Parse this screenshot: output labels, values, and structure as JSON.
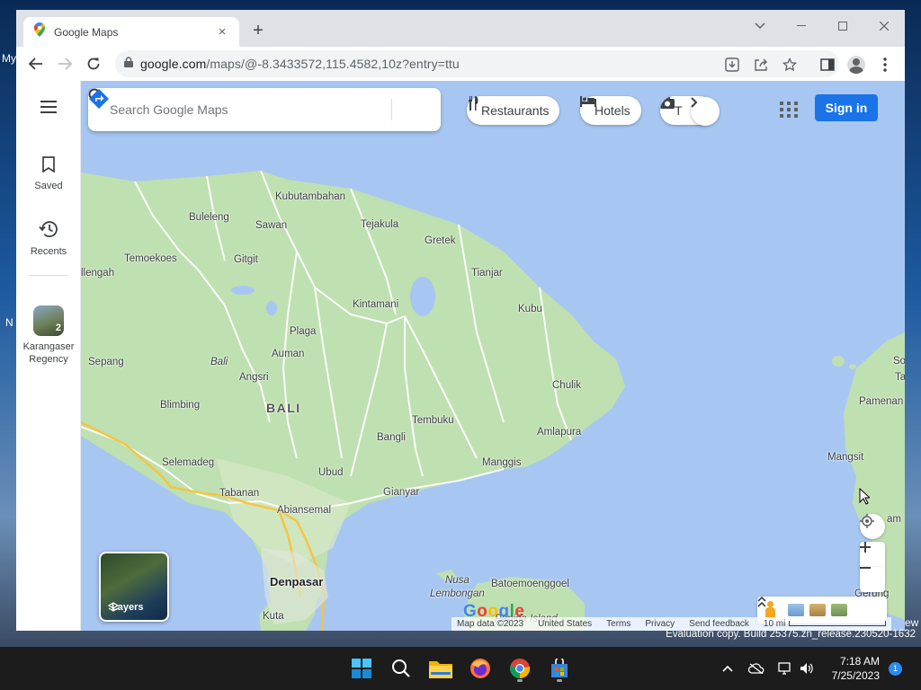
{
  "browser": {
    "tab_title": "Google Maps",
    "new_tab": "+",
    "tab_close": "×",
    "url_host": "google.com",
    "url_path": "/maps/@-8.3433572,115.4582,10z?entry=ttu"
  },
  "rail": {
    "saved_label": "Saved",
    "recents_label": "Recents",
    "recent_place_label": "Karangaser Regency",
    "recent_place_count": "2"
  },
  "search": {
    "placeholder": "Search Google Maps"
  },
  "chips": {
    "restaurants": "Restaurants",
    "hotels": "Hotels",
    "things": "T"
  },
  "account": {
    "sign_in": "Sign in"
  },
  "layers": {
    "label": "Layers"
  },
  "map_labels": {
    "kubutambahan": "Kubutambahan",
    "buleleng": "Buleleng",
    "sawan": "Sawan",
    "tejakula": "Tejakula",
    "gretek": "Gretek",
    "temoekoes": "Temoekoes",
    "gitgit": "Gitgit",
    "tianjar": "Tianjar",
    "llengah": "llengah",
    "kintamani": "Kintamani",
    "kubu": "Kubu",
    "plaga": "Plaga",
    "auman": "Auman",
    "sepang": "Sepang",
    "bali_italic": "Bali",
    "angsri": "Angsri",
    "chulik": "Chulik",
    "bali": "BALI",
    "blimbing": "Blimbing",
    "tembuku": "Tembuku",
    "amlapura": "Amlapura",
    "bangli": "Bangli",
    "selemadeg": "Selemadeg",
    "manggis": "Manggis",
    "ubud": "Ubud",
    "gianyar": "Gianyar",
    "tabanan": "Tabanan",
    "abiansemal": "Abiansemal",
    "denpasar": "Denpasar",
    "nusa_lembongan": "Nusa\nLembongan",
    "batoemoenggoel": "Batoemoenggoel",
    "penida_island": "Penida Island",
    "kuta": "Kuta",
    "mangsit": "Mangsit",
    "pamenan": "Pamenan",
    "so": "So",
    "ta": "Ta",
    "ngam": "am",
    "gerung": "Gerung"
  },
  "attribution": {
    "map_data": "Map data ©2023",
    "country": "United States",
    "terms": "Terms",
    "privacy": "Privacy",
    "feedback": "Send feedback",
    "scale": "10 mi"
  },
  "logo": {
    "text": "Google"
  },
  "desktop": {
    "frag_my": "My",
    "frag_n": "N",
    "frag_ew": "ew",
    "eval_text": "Evaluation copy. Build 25375.zn_release.230520-1632"
  },
  "taskbar": {
    "time": "7:18 AM",
    "date": "7/25/2023",
    "notifications": "1"
  },
  "colors": {
    "water": "#a7c7f2",
    "land": "#bfe0b0",
    "accent": "#1a73e8"
  }
}
